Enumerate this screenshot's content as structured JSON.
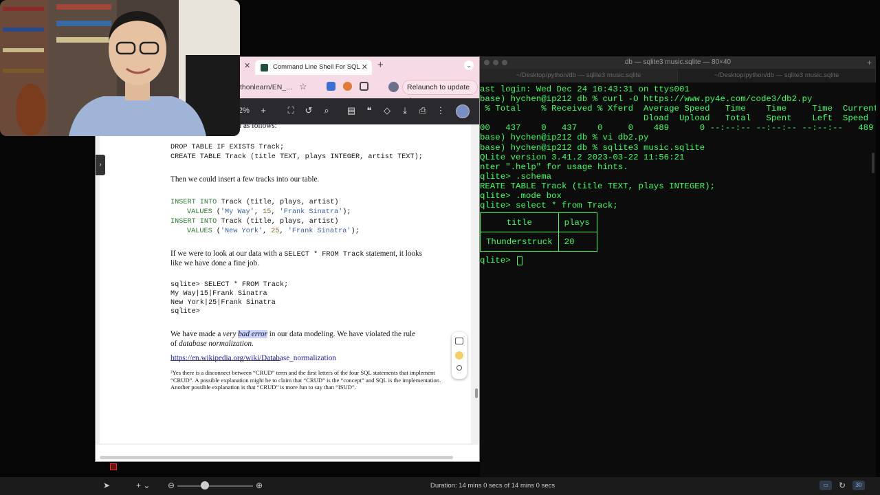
{
  "terminal": {
    "window_title": "db — sqlite3 music.sqlite — 80×40",
    "tabs": [
      "~/Desktop/python/db — sqlite3 music.sqlite",
      "~/Desktop/python/db — sqlite3 music.sqlite"
    ],
    "lines": [
      "ast login: Wed Dec 24 10:43:31 on ttys001",
      "base) hychen@ip212 db % curl -O https://www.py4e.com/code3/db2.py",
      " % Total    % Received % Xferd  Average Speed   Time    Time     Time  Current",
      "                                Dload  Upload   Total   Spent    Left  Speed",
      "00   437    0   437    0     0    489      0 --:--:-- --:--:-- --:--:--   489",
      "base) hychen@ip212 db % vi db2.py",
      "base) hychen@ip212 db % sqlite3 music.sqlite",
      "QLite version 3.41.2 2023-03-22 11:56:21",
      "nter \".help\" for usage hints.",
      "qlite> .schema",
      "REATE TABLE Track (title TEXT, plays INTEGER);",
      "qlite> .mode box",
      "qlite> select * from Track;"
    ],
    "table": {
      "headers": [
        "title",
        "plays"
      ],
      "row": [
        "Thunderstruck",
        "20"
      ]
    },
    "prompt": "qlite> "
  },
  "browser": {
    "tab_title": "Command Line Shell For SQL",
    "url": "thonlearn/EN_...",
    "relaunch_label": "Relaunch to update",
    "zoom": "2%",
    "colors": {
      "tabbar": "#f6dbe7",
      "pdf_toolbar": "#2a2a2e"
    }
  },
  "pdf": {
    "cut_line": "the artist in the column as follows:",
    "code1": [
      "DROP TABLE IF EXISTS Track;",
      "CREATE TABLE Track (title TEXT, plays INTEGER, artist TEXT);"
    ],
    "para1": "Then we could insert a few tracks into our table.",
    "insert": {
      "kw": "INSERT INTO",
      "rest": " Track (title, plays, artist)",
      "values_kw": "VALUES",
      "row1": {
        "s1": "'My Way'",
        "n": "15",
        "s2": "'Frank Sinatra'"
      },
      "row2": {
        "s1": "'New York'",
        "n": "25",
        "s2": "'Frank Sinatra'"
      }
    },
    "para2_a": "If we were to look at our data with a ",
    "para2_code": "SELECT * FROM Track",
    "para2_b": " statement, it looks",
    "para2_c": "like we have done a fine job.",
    "output": [
      "sqlite> SELECT * FROM Track;",
      "My Way|15|Frank Sinatra",
      "New York|25|Frank Sinatra",
      "sqlite>"
    ],
    "para3_a": "We have made a ",
    "para3_very": "very",
    "para3_hl": "bad error",
    "para3_b": " in our data modeling. We have violated the rule",
    "para3_c": "of ",
    "para3_em": "database normalization.",
    "link": "https://en.wikipedia.org/wiki/Database_normalization",
    "footnote": "²Yes there is a disconnect between “CRUD” term and the first letters of the four SQL statements that implement “CRUD”. A possible explanation might be to claim that “CRUD” is the “concept” and SQL is the implementation. Another possible explanation is that “CRUD” is more fun to say than “ISUD”."
  },
  "bottom": {
    "duration": "Duration: 14 mins 0 secs of 14 mins 0 secs",
    "badge": "30"
  }
}
